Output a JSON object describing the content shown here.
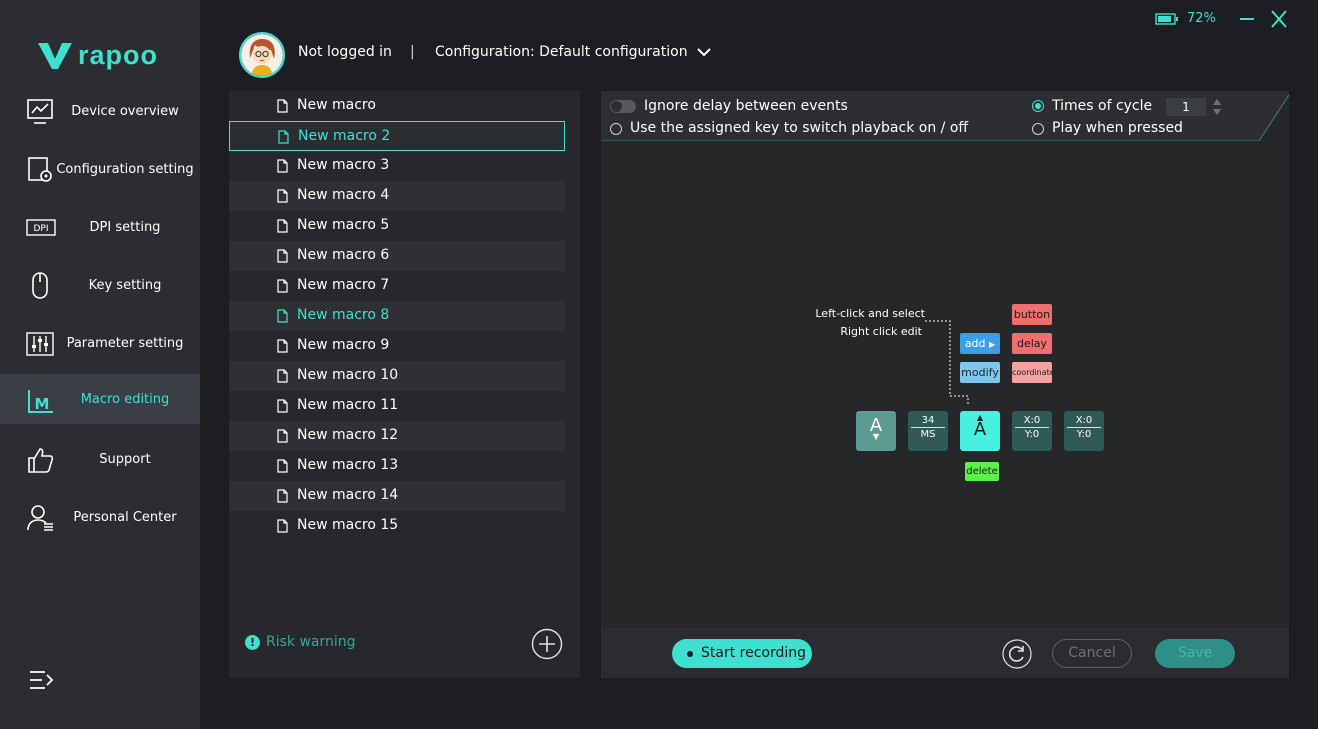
{
  "brand": {
    "logo_text": "rapoo"
  },
  "top_bar": {
    "battery_percent": "72%",
    "minimize_icon": "minimize-icon",
    "close_icon": "close-icon"
  },
  "header": {
    "login_status": "Not logged in",
    "separator": "|",
    "configuration": "Configuration: Default configuration"
  },
  "sidebar": {
    "items": [
      {
        "label": "Device overview",
        "icon": "monitor-chart-icon"
      },
      {
        "label": "Configuration setting",
        "icon": "config-gear-icon"
      },
      {
        "label": "DPI setting",
        "icon": "dpi-icon"
      },
      {
        "label": "Key setting",
        "icon": "mouse-icon"
      },
      {
        "label": "Parameter setting",
        "icon": "sliders-icon"
      },
      {
        "label": "Macro editing",
        "icon": "macro-icon",
        "active": true
      },
      {
        "label": "Support",
        "icon": "thumbs-up-icon"
      },
      {
        "label": "Personal Center",
        "icon": "user-icon"
      }
    ]
  },
  "macros": {
    "items": [
      "New macro",
      "New macro 2",
      "New macro 3",
      "New macro 4",
      "New macro 5",
      "New macro 6",
      "New macro 7",
      "New macro 8",
      "New macro 9",
      "New macro 10",
      "New macro 11",
      "New macro 12",
      "New macro 13",
      "New macro 14",
      "New macro 15"
    ],
    "selected_index": 1,
    "highlighted_index": 7,
    "risk_warning": "Risk warning"
  },
  "options": {
    "ignore_delay": "Ignore delay between events",
    "assigned_key": "Use the assigned key to switch playback on / off",
    "times_of_cycle": "Times of cycle",
    "cycle_value": "1",
    "play_when_pressed": "Play when pressed"
  },
  "tutorial": {
    "hint_line1": "Left-click and select",
    "hint_line2": "Right click edit",
    "add": "add",
    "modify": "modify",
    "button": "button",
    "delay": "delay",
    "coordinate": "coordinate",
    "delete": "delete",
    "block_key": "A",
    "block_ms_value": "34",
    "block_ms_unit": "MS",
    "block_x": "X:0",
    "block_y": "Y:0"
  },
  "bottom_bar": {
    "start_recording": "Start recording",
    "cancel": "Cancel",
    "save": "Save"
  },
  "colors": {
    "accent": "#3fe0d0",
    "sidebar_bg": "#2b2d31",
    "panel_bg": "#26282c"
  }
}
